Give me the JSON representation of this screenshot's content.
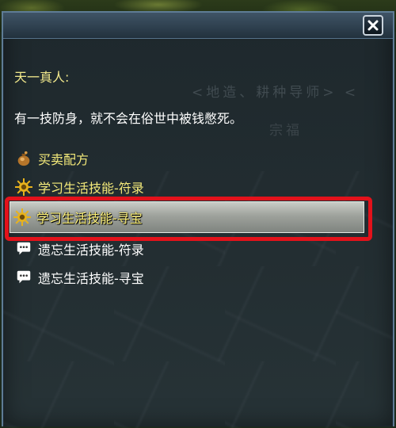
{
  "dialog": {
    "speaker": "天一真人:",
    "text": "有一技防身，就不会在俗世中被钱憋死。",
    "background_glyphs": "<地造、耕种导师>  <",
    "background_glyphs_2": "宗福"
  },
  "options": [
    {
      "label": "买卖配方",
      "icon": "money-bag-icon"
    },
    {
      "label": "学习生活技能-符录",
      "icon": "sun-gear-icon"
    },
    {
      "label": "学习生活技能-寻宝",
      "icon": "sun-gear-icon",
      "selected": true
    },
    {
      "label": "遗忘生活技能-符录",
      "icon": "speech-bubble-icon"
    },
    {
      "label": "遗忘生活技能-寻宝",
      "icon": "speech-bubble-icon"
    }
  ],
  "colors": {
    "accent_yellow": "#f4ea7a",
    "highlight_red": "#e3121b",
    "panel_border": "#5e7c95"
  }
}
